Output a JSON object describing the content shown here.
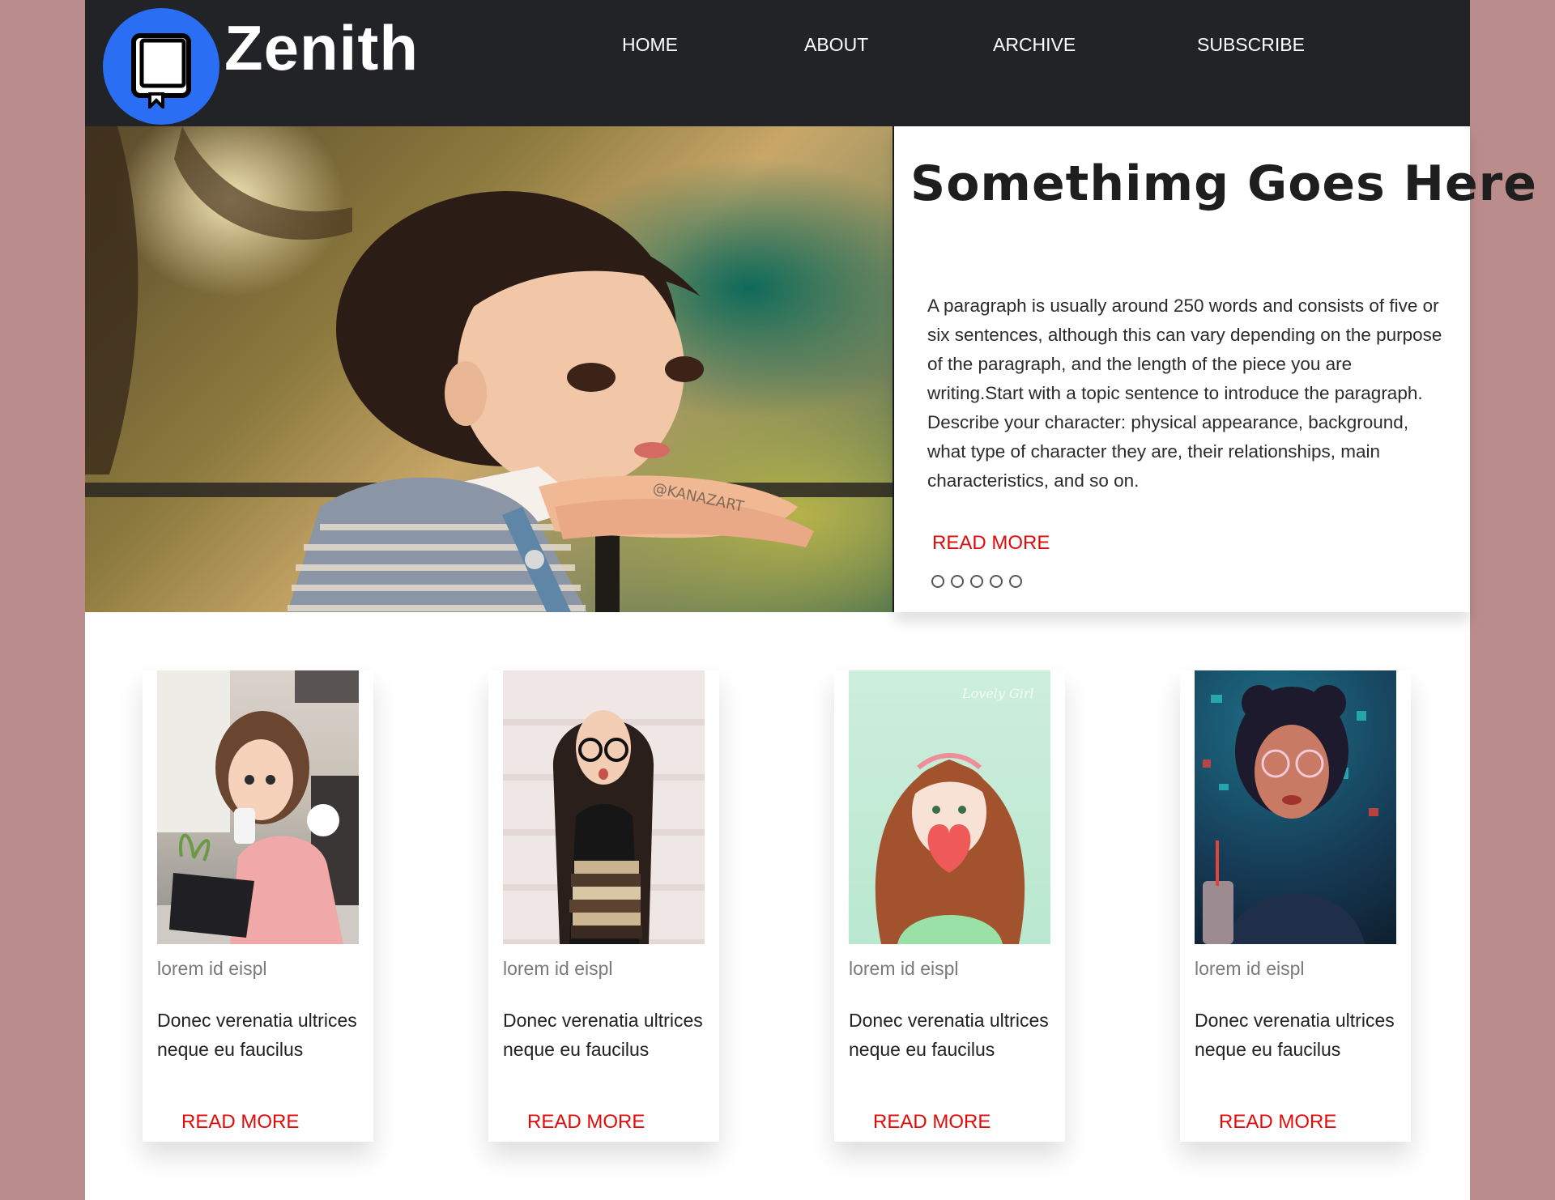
{
  "brand": {
    "name": "Zenith",
    "logo_icon": "book-icon",
    "logo_color": "#2a6ef4"
  },
  "nav": {
    "items": [
      {
        "label": "HOME"
      },
      {
        "label": "ABOUT"
      },
      {
        "label": "ARCHIVE"
      },
      {
        "label": "SUBSCRIBE"
      }
    ]
  },
  "hero": {
    "title": "Somethimg Goes Here",
    "paragraph": "A paragraph is usually around 250 words and consists of five or six sentences, although this can vary depending on the purpose of the paragraph, and the length of the piece you are writing.Start with a topic sentence to introduce the paragraph. Describe your character: physical appearance, background, what type of character they are, their relationships, main characteristics, and so on.",
    "read_more": "READ MORE",
    "image_watermark": "@KANAZART",
    "slide_count": 5
  },
  "cards": [
    {
      "category": "lorem id eispl",
      "title": "Donec verenatia ultrices neque eu faucilus",
      "read_more": "READ MORE"
    },
    {
      "category": "lorem id eispl",
      "title": "Donec verenatia ultrices neque eu faucilus",
      "read_more": "READ MORE"
    },
    {
      "category": "lorem id eispl",
      "title": "Donec verenatia ultrices neque eu faucilus",
      "read_more": "READ MORE",
      "image_caption": "Lovely Girl"
    },
    {
      "category": "lorem id eispl",
      "title": "Donec verenatia ultrices neque eu faucilus",
      "read_more": "READ MORE"
    }
  ],
  "colors": {
    "accent": "#e10b0b",
    "navbar": "#212327",
    "page_bg": "#bb8c8c"
  }
}
